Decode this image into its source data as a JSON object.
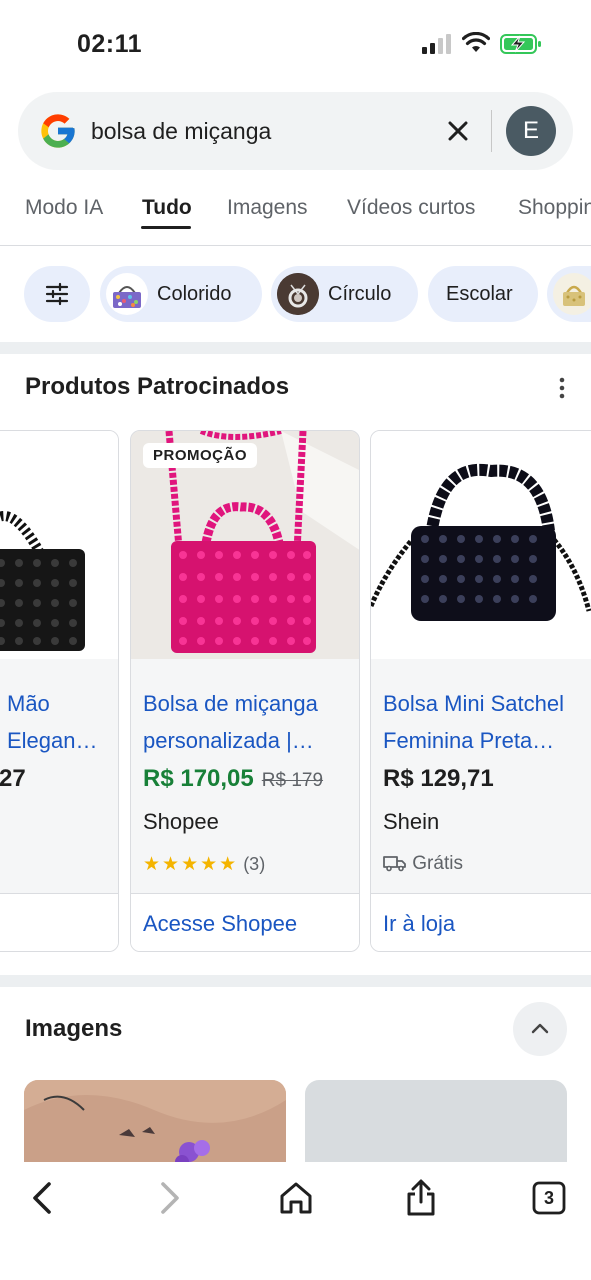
{
  "status_bar": {
    "time": "02:11",
    "icons": [
      "signal-icon",
      "wifi-icon",
      "battery-charging-icon"
    ]
  },
  "search": {
    "logo": "google-logo",
    "query": "bolsa de miçanga",
    "clear_icon": "close-icon",
    "avatar_letter": "E"
  },
  "tabs": [
    {
      "label": "Modo IA"
    },
    {
      "label": "Tudo"
    },
    {
      "label": "Imagens"
    },
    {
      "label": "Vídeos curtos"
    },
    {
      "label": "Shoppin"
    }
  ],
  "chips": [
    {
      "label": "",
      "icon": "tune-icon"
    },
    {
      "label": "Colorido"
    },
    {
      "label": "Círculo"
    },
    {
      "label": "Escolar"
    }
  ],
  "sponsored": {
    "title": "Produtos Patrocinados",
    "menu_icon": "more-vert-icon",
    "cards": [
      {
        "title_line1": "Mão",
        "title_line2": "Elegan…",
        "price": "27"
      },
      {
        "badge": "PROMOÇÃO",
        "title_line1": "Bolsa de miçanga",
        "title_line2": "personalizada |…",
        "price": "R$ 170,05",
        "old_price": "R$ 179",
        "store": "Shopee",
        "stars": "★★★★★",
        "rating_count": "(3)",
        "link": "Acesse Shopee"
      },
      {
        "title_line1": "Bolsa Mini Satchel",
        "title_line2": "Feminina Preta…",
        "price": "R$ 129,71",
        "store": "Shein",
        "shipping": "Grátis",
        "link": "Ir à loja"
      }
    ]
  },
  "images_section": {
    "title": "Imagens",
    "collapse_icon": "chevron-up-icon"
  },
  "toolbar": {
    "tab_count": "3",
    "icons": [
      "back-icon",
      "forward-icon",
      "home-icon",
      "share-icon",
      "tabs-icon"
    ]
  },
  "colors": {
    "link_blue": "#1a56c2",
    "price_green": "#188038",
    "chip_bg": "#e8eefb",
    "star": "#f4b400"
  }
}
